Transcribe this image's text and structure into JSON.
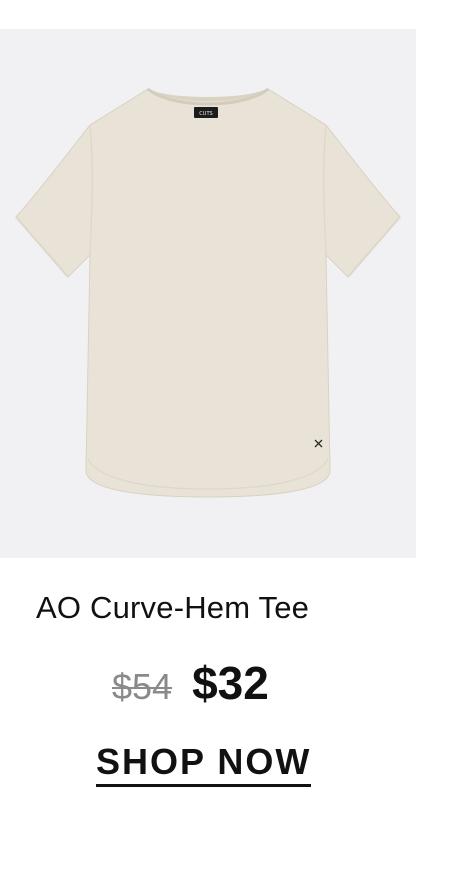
{
  "product": {
    "name": "AO Curve-Hem Tee",
    "original_price": "$54",
    "sale_price": "$32",
    "neck_label_text": "CUTS",
    "shirt_color": "#e8e3d6",
    "image_background": "#f1f1f3"
  },
  "cta": {
    "label": "SHOP NOW"
  }
}
